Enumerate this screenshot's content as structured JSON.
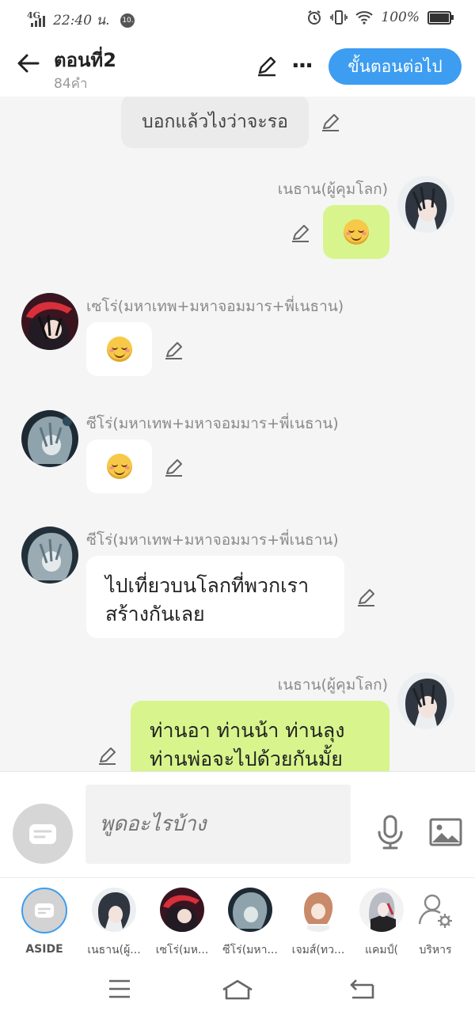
{
  "status_bar": {
    "network": "4G",
    "time": "22:40 น.",
    "notif_badge": "10.",
    "battery_pct": "100%"
  },
  "header": {
    "title": "ตอนที่2",
    "word_count": "84คำ",
    "next_label": "ขั้นตอนต่อไป"
  },
  "messages": [
    {
      "type": "narration",
      "text": "บอกแล้วไงว่าจะรอ"
    },
    {
      "type": "right",
      "name": "เนธาน(ผู้คุมโลก)",
      "emoji": "smile"
    },
    {
      "type": "left",
      "name": "เซโร่(มหาเทพ+มหาจอมมาร+พี่เนธาน)",
      "emoji": "smile"
    },
    {
      "type": "left",
      "name": "ซีโร่(มหาเทพ+มหาจอมมาร+พี่เนธาน)",
      "emoji": "smile"
    },
    {
      "type": "left",
      "name": "ซีโร่(มหาเทพ+มหาจอมมาร+พี่เนธาน)",
      "line1": "ไปเที่ยวบนโลกที่พวกเรา",
      "line2": "สร้างกันเลย"
    },
    {
      "type": "right",
      "name": "เนธาน(ผู้คุมโลก)",
      "line1": "ท่านอา ท่านน้า ท่านลุง",
      "line2": "ท่านพ่อจะไปด้วยกันมั้ย"
    }
  ],
  "composer": {
    "placeholder": "พูดอะไรบ้าง"
  },
  "characters": [
    {
      "label": "ASIDE"
    },
    {
      "label": "เนธาน(ผู้..."
    },
    {
      "label": "เซโร่(มห..."
    },
    {
      "label": "ซีโร่(มหา..."
    },
    {
      "label": "เจมส์(ทว..."
    },
    {
      "label": "แคมป์("
    },
    {
      "label": "บริหาร"
    }
  ],
  "colors": {
    "accent": "#3d9df0",
    "right_bubble": "#d7f58c",
    "left_bubble": "#ffffff",
    "narration": "#ebebeb"
  }
}
